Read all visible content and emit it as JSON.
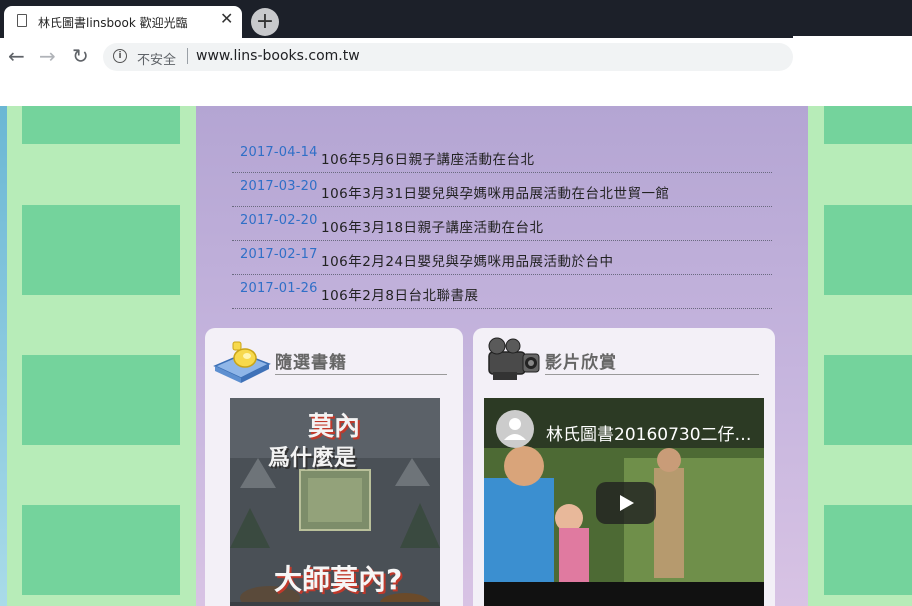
{
  "browser": {
    "tab_title": "林氏圖書linsbook 歡迎光臨",
    "tab_close": "✕",
    "new_tab": "+",
    "back": "←",
    "forward": "→",
    "reload": "↻",
    "security_label": "不安全",
    "url": "www.lins-books.com.tw",
    "bookmark": "☆"
  },
  "news": [
    {
      "date": "2017-04-14",
      "title": "106年5月6日親子講座活動在台北"
    },
    {
      "date": "2017-03-20",
      "title": "106年3月31日嬰兒與孕媽咪用品展活動在台北世貿一館"
    },
    {
      "date": "2017-02-20",
      "title": "106年3月18日親子講座活動在台北"
    },
    {
      "date": "2017-02-17",
      "title": "106年2月24日嬰兒與孕媽咪用品展活動於台中"
    },
    {
      "date": "2017-01-26",
      "title": "106年2月8日台北聯書展"
    }
  ],
  "books_panel": {
    "title": "隨選書籍",
    "cover_title_top": "莫內",
    "cover_title_mid": "爲什麼是",
    "cover_title_bottom": "大師莫內?"
  },
  "video_panel": {
    "title": "影片欣賞",
    "video_title": "林氏圖書20160730二仔…"
  },
  "colors": {
    "page_green": "#b7ecb8",
    "block_green": "#74d39c",
    "center_purple": "#b4a5d3",
    "date_blue": "#2f6fc7"
  }
}
